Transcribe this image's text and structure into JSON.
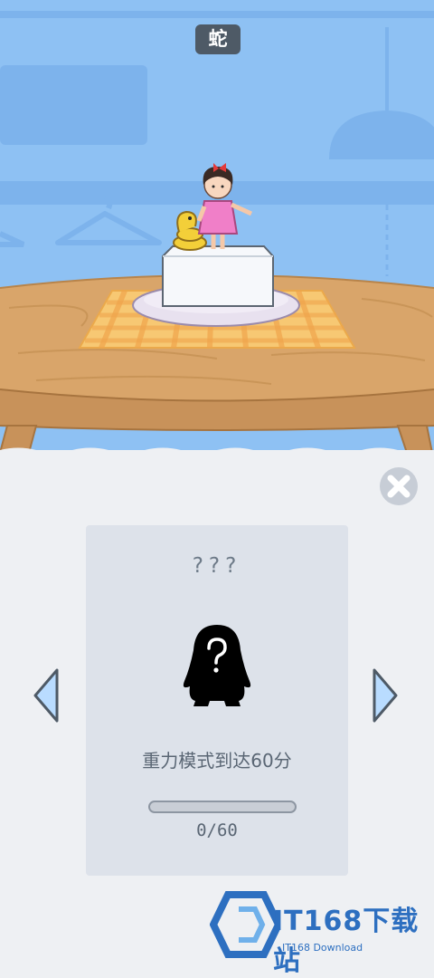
{
  "animal": {
    "name": "蛇"
  },
  "card": {
    "name_hidden": "???",
    "condition": "重力模式到达60分",
    "progress": {
      "current": 0,
      "target": 60,
      "label": "0/60"
    }
  },
  "icons": {
    "close": "close-icon",
    "prev": "chevron-left-icon",
    "next": "chevron-right-icon",
    "locked": "question-silhouette-icon"
  },
  "watermark": {
    "brand": "IT168下载站",
    "sub": "IT168 Download"
  },
  "colors": {
    "sky": "#8ec1f3",
    "table": "#d9a56a",
    "panel": "#eef0f3",
    "card": "#dde2ea",
    "accent_text": "#5a6674"
  }
}
